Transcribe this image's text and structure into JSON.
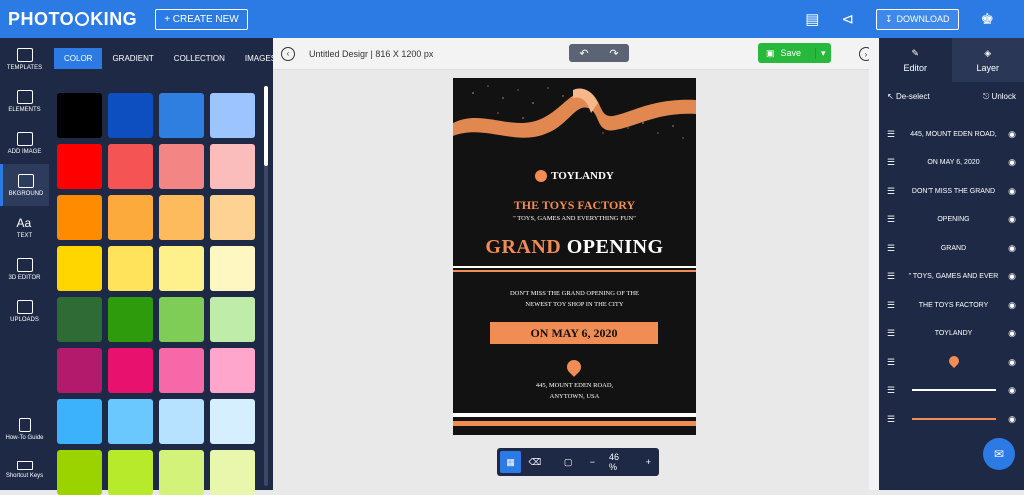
{
  "app": {
    "logo_left": "PHOTO",
    "logo_right": "KING",
    "create_label": "+ CREATE NEW",
    "download_label": "DOWNLOAD"
  },
  "rail": [
    {
      "label": "TEMPLATES",
      "icon": "templates-icon"
    },
    {
      "label": "ELEMENTS",
      "icon": "elements-icon"
    },
    {
      "label": "ADD IMAGE",
      "icon": "add-image-icon"
    },
    {
      "label": "BKGROUND",
      "icon": "background-icon"
    },
    {
      "label": "TEXT",
      "icon": "text-icon"
    },
    {
      "label": "3D EDITOR",
      "icon": "3d-editor-icon"
    },
    {
      "label": "UPLOADS",
      "icon": "uploads-icon"
    }
  ],
  "rail_bottom": [
    {
      "label": "How-To Guide"
    },
    {
      "label": "Shortcut Keys"
    }
  ],
  "panel_tabs": [
    {
      "label": "COLOR"
    },
    {
      "label": "GRADIENT"
    },
    {
      "label": "COLLECTION"
    },
    {
      "label": "IMAGES"
    }
  ],
  "swatches": [
    "#000000",
    "#0d4fc0",
    "#2f7fe0",
    "#9cc4ff",
    "#ff0000",
    "#f55454",
    "#f48585",
    "#fbbcbc",
    "#ff8c00",
    "#fdaa3d",
    "#fdbb5e",
    "#fdd293",
    "#ffd600",
    "#ffe35a",
    "#fef08a",
    "#fff7c2",
    "#2f6b35",
    "#2e9b0d",
    "#7fcc56",
    "#c0ecaa",
    "#b31a6c",
    "#e8116e",
    "#f768a8",
    "#ffa6cd",
    "#3cb2fd",
    "#6ac8ff",
    "#b7e2ff",
    "#d6efff",
    "#9bd300",
    "#b7ea2b",
    "#d3f27a",
    "#e9f7ad"
  ],
  "canvas": {
    "doc_title": "Untitled Desigr",
    "doc_size": "816 X 1200 px",
    "save_label": "Save",
    "zoom": "46 %"
  },
  "poster": {
    "brand": "TOYLANDY",
    "factory": "THE TOYS FACTORY",
    "tagline": "\" TOYS, GAMES AND EVERYTHING FUN\"",
    "grand": "GRAND",
    "opening": "OPENING",
    "dont_line1": "DON'T MISS THE GRAND OPENING OF THE",
    "dont_line2": "NEWEST TOY SHOP IN THE CITY",
    "date": "ON MAY 6, 2020",
    "addr_line1": "445, MOUNT EDEN ROAD,",
    "addr_line2": "ANYTOWN, USA",
    "accent": "#f28c55"
  },
  "right": {
    "tab_editor": "Editor",
    "tab_layer": "Layer",
    "deselect": "De-select",
    "unlock": "Unlock",
    "layers": [
      {
        "label": "445, MOUNT EDEN ROAD,"
      },
      {
        "label": "ON MAY 6, 2020"
      },
      {
        "label": "DON'T MISS THE GRAND"
      },
      {
        "label": "OPENING"
      },
      {
        "label": "GRAND"
      },
      {
        "label": "\" TOYS, GAMES AND EVER"
      },
      {
        "label": "THE TOYS FACTORY"
      },
      {
        "label": "TOYLANDY"
      },
      {
        "label": ""
      },
      {
        "label": ""
      },
      {
        "label": ""
      }
    ]
  }
}
